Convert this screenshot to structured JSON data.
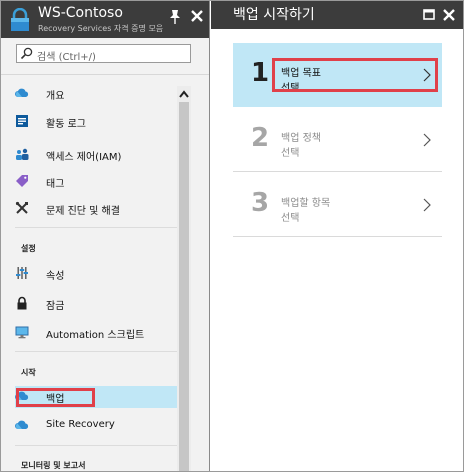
{
  "vault": {
    "title": "WS-Contoso",
    "subtitle": "Recovery Services 자격 증명 모음"
  },
  "search": {
    "placeholder": "검색 (Ctrl+/)"
  },
  "menu": {
    "overview": "개요",
    "activity_log": "활동 로그",
    "iam": "액세스 제어(IAM)",
    "tags": "태그",
    "diagnose": "문제 진단 및 해결",
    "section_settings": "설정",
    "properties": "속성",
    "locks": "잠금",
    "automation": "Automation 스크립트",
    "section_start": "시작",
    "backup": "백업",
    "site_recovery": "Site Recovery",
    "section_monitoring": "모니터링 및 보고서"
  },
  "blade": {
    "title": "백업 시작하기",
    "steps": [
      {
        "number": "1",
        "line1": "백업 목표",
        "line2": "선택"
      },
      {
        "number": "2",
        "line1": "백업 정책",
        "line2": "선택"
      },
      {
        "number": "3",
        "line1": "백업할 항목",
        "line2": "선택"
      }
    ]
  },
  "colors": {
    "header_bg": "#3c3c3c",
    "selected_bg": "#c0e7f6",
    "highlight_border": "#e04049",
    "accent_blue": "#0072c6"
  },
  "icons": [
    "vault-icon",
    "pin-icon",
    "close-icon",
    "search-icon",
    "cloud-icon",
    "log-icon",
    "people-icon",
    "tag-icon",
    "wrench-icon",
    "sliders-icon",
    "lock-icon",
    "monitor-icon",
    "chevron-right-icon",
    "maximize-icon"
  ]
}
